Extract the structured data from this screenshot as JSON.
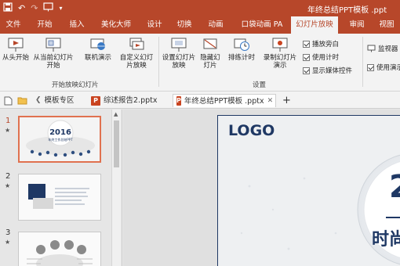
{
  "window": {
    "title": "年终总结PPT模板 .ppt"
  },
  "ribbon_tabs": [
    {
      "label": "文件"
    },
    {
      "label": "开始"
    },
    {
      "label": "插入"
    },
    {
      "label": "美化大师"
    },
    {
      "label": "设计"
    },
    {
      "label": "切换"
    },
    {
      "label": "动画"
    },
    {
      "label": "口袋动画 PA"
    },
    {
      "label": "幻灯片放映",
      "active": true
    },
    {
      "label": "审阅"
    },
    {
      "label": "视图"
    }
  ],
  "ribbon": {
    "from_start": "从头开始",
    "from_current": "从当前幻灯片开始",
    "online": "联机演示",
    "custom": "自定义幻灯片放映",
    "group_start": "开始放映幻灯片",
    "setup_show": "设置幻灯片放映",
    "hide_slide": "隐藏幻灯片",
    "rehearse": "排练计时",
    "record": "录制幻灯片演示",
    "play_narration": "播放旁白",
    "use_timings": "使用计时",
    "show_media": "显示媒体控件",
    "group_setup": "设置",
    "monitor": "监视器",
    "use_presenter": "使用演示"
  },
  "doc_tabs": [
    {
      "label": "模板专区"
    },
    {
      "label": "综述报告2.pptx"
    },
    {
      "label": "年终总结PPT模板 .pptx",
      "active": true,
      "close": "✕"
    },
    {
      "label": "+"
    }
  ],
  "thumbnails": [
    {
      "num": "1",
      "star": "★",
      "year": "2016",
      "subtitle": "年终工作总结PPT"
    },
    {
      "num": "2",
      "star": "★"
    },
    {
      "num": "3",
      "star": "★"
    }
  ],
  "slide": {
    "logo": "LOGO",
    "big_number": "2",
    "big_text": "时尚"
  },
  "colors": {
    "accent": "#b7472a",
    "navy": "#1f3864"
  }
}
